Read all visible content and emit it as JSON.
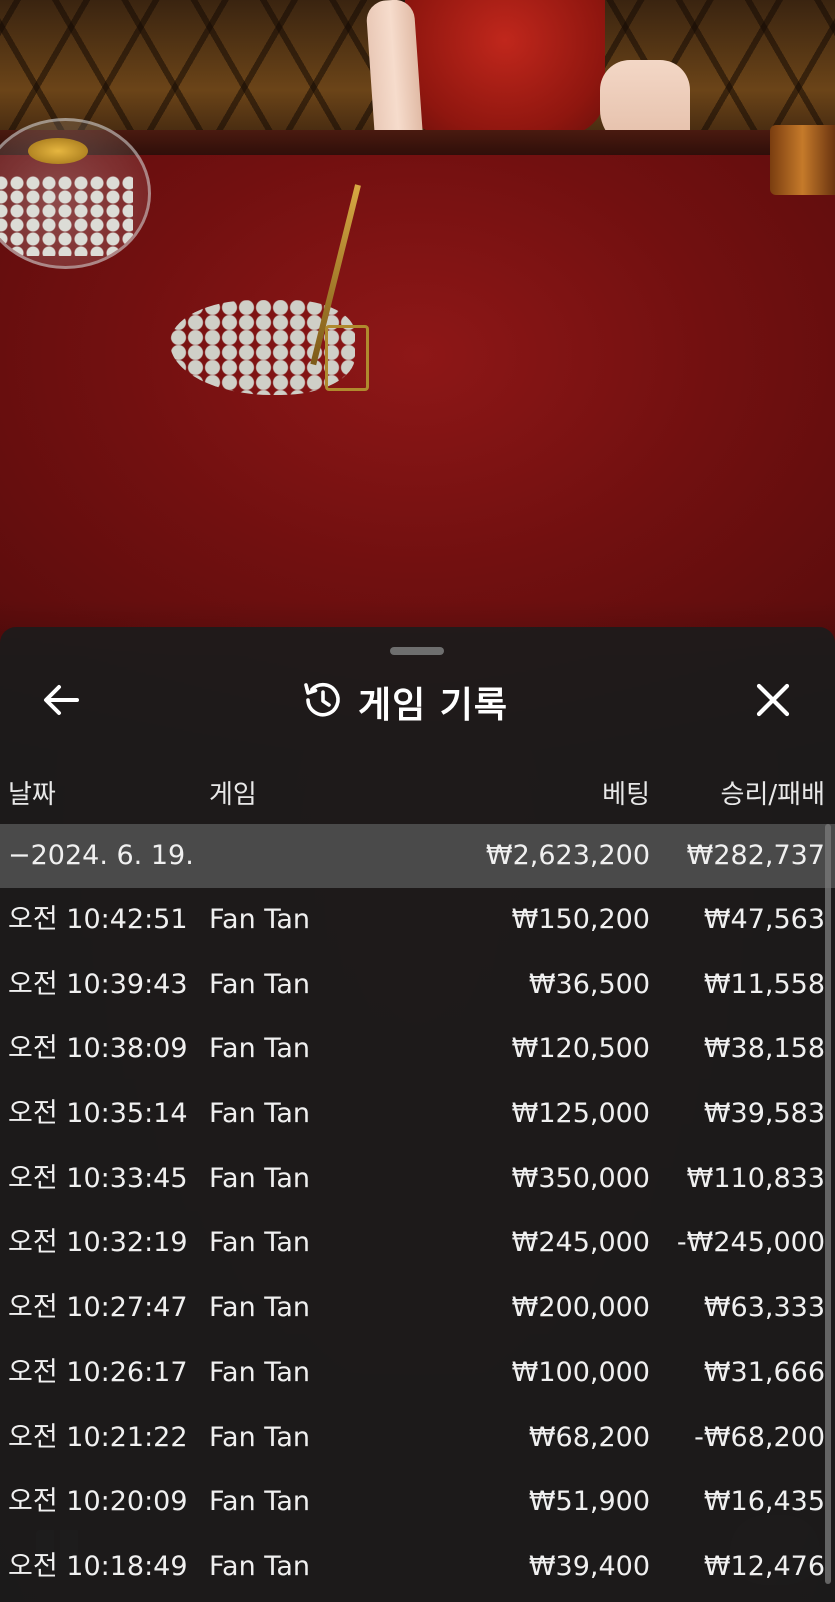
{
  "sheet": {
    "title": "게임 기록",
    "icons": {
      "back": "arrow-left-icon",
      "history": "history-clock-icon",
      "close": "close-icon"
    }
  },
  "columns": {
    "date": "날짜",
    "game": "게임",
    "bet": "베팅",
    "result": "승리/패배"
  },
  "date_group": {
    "label": "−2024. 6. 19.",
    "bet_total": "₩2,623,200",
    "result_total": "₩282,737"
  },
  "rows": [
    {
      "time": "오전 10:42:51",
      "game": "Fan Tan",
      "bet": "₩150,200",
      "result": "₩47,563"
    },
    {
      "time": "오전 10:39:43",
      "game": "Fan Tan",
      "bet": "₩36,500",
      "result": "₩11,558"
    },
    {
      "time": "오전 10:38:09",
      "game": "Fan Tan",
      "bet": "₩120,500",
      "result": "₩38,158"
    },
    {
      "time": "오전 10:35:14",
      "game": "Fan Tan",
      "bet": "₩125,000",
      "result": "₩39,583"
    },
    {
      "time": "오전 10:33:45",
      "game": "Fan Tan",
      "bet": "₩350,000",
      "result": "₩110,833"
    },
    {
      "time": "오전 10:32:19",
      "game": "Fan Tan",
      "bet": "₩245,000",
      "result": "-₩245,000"
    },
    {
      "time": "오전 10:27:47",
      "game": "Fan Tan",
      "bet": "₩200,000",
      "result": "₩63,333"
    },
    {
      "time": "오전 10:26:17",
      "game": "Fan Tan",
      "bet": "₩100,000",
      "result": "₩31,666"
    },
    {
      "time": "오전 10:21:22",
      "game": "Fan Tan",
      "bet": "₩68,200",
      "result": "-₩68,200"
    },
    {
      "time": "오전 10:20:09",
      "game": "Fan Tan",
      "bet": "₩51,900",
      "result": "₩16,435"
    },
    {
      "time": "오전 10:18:49",
      "game": "Fan Tan",
      "bet": "₩39,400",
      "result": "₩12,476"
    }
  ],
  "colors": {
    "sheet_bg": "#1c1c1c",
    "date_row_bg": "#4a4a4a",
    "text": "#f0f0f0",
    "table_felt": "#7a1212"
  }
}
